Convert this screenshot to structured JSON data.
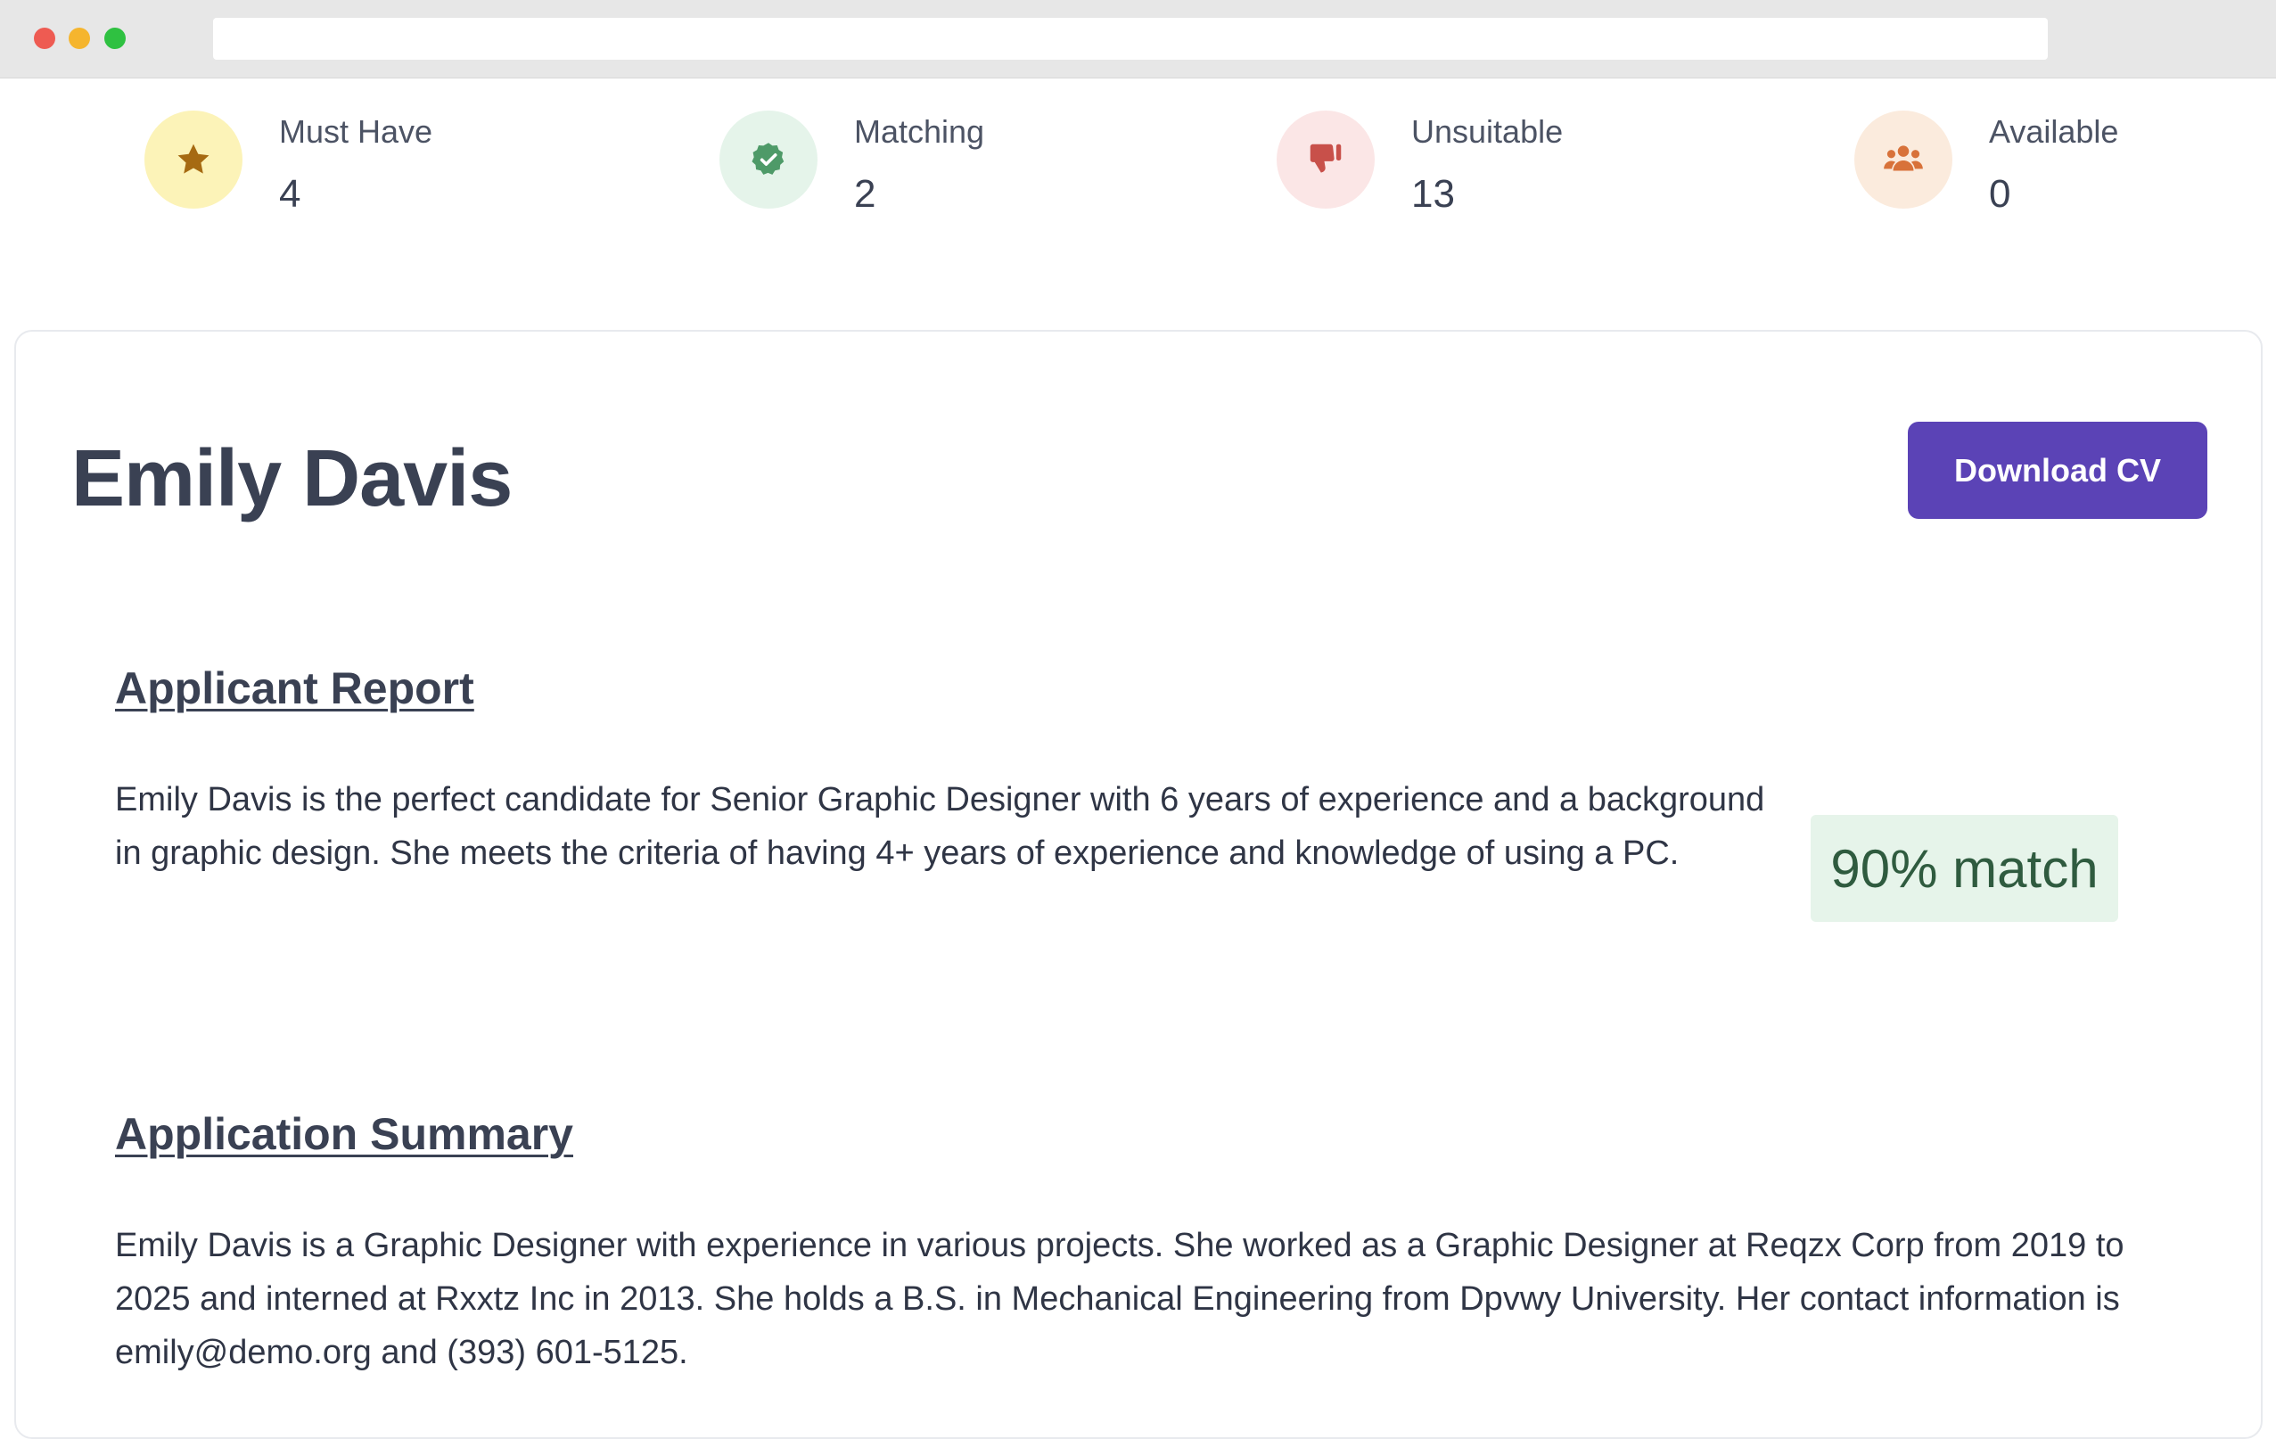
{
  "window": {
    "url": ""
  },
  "stats": [
    {
      "label": "Must Have",
      "value": "4",
      "icon": "star-icon",
      "bg": "#fcf3b8",
      "fg": "#a66a12"
    },
    {
      "label": "Matching",
      "value": "2",
      "icon": "check-badge-icon",
      "bg": "#e5f4ea",
      "fg": "#4e9a68"
    },
    {
      "label": "Unsuitable",
      "value": "13",
      "icon": "thumbs-down-icon",
      "bg": "#fbe6e6",
      "fg": "#c8504a"
    },
    {
      "label": "Available",
      "value": "0",
      "icon": "people-group-icon",
      "bg": "#fbebdd",
      "fg": "#d8723a"
    }
  ],
  "candidate": {
    "name": "Emily Davis",
    "download_label": "Download CV",
    "button_color": "#5b43b6"
  },
  "report": {
    "title": "Applicant Report",
    "text": "Emily Davis is the perfect candidate for Senior Graphic Designer with 6 years of experience and a background in graphic design. She meets the criteria of having 4+ years of experience and knowledge of using a PC.",
    "match_label": "90% match"
  },
  "summary": {
    "title": "Application Summary",
    "text": "Emily Davis is a Graphic Designer with experience in various projects. She worked as a Graphic Designer at Reqzx Corp from 2019 to 2025 and interned at Rxxtz Inc in 2013. She holds a B.S. in Mechanical Engineering from Dpvwy University. Her contact information is emily@demo.org and (393) 601-5125."
  }
}
